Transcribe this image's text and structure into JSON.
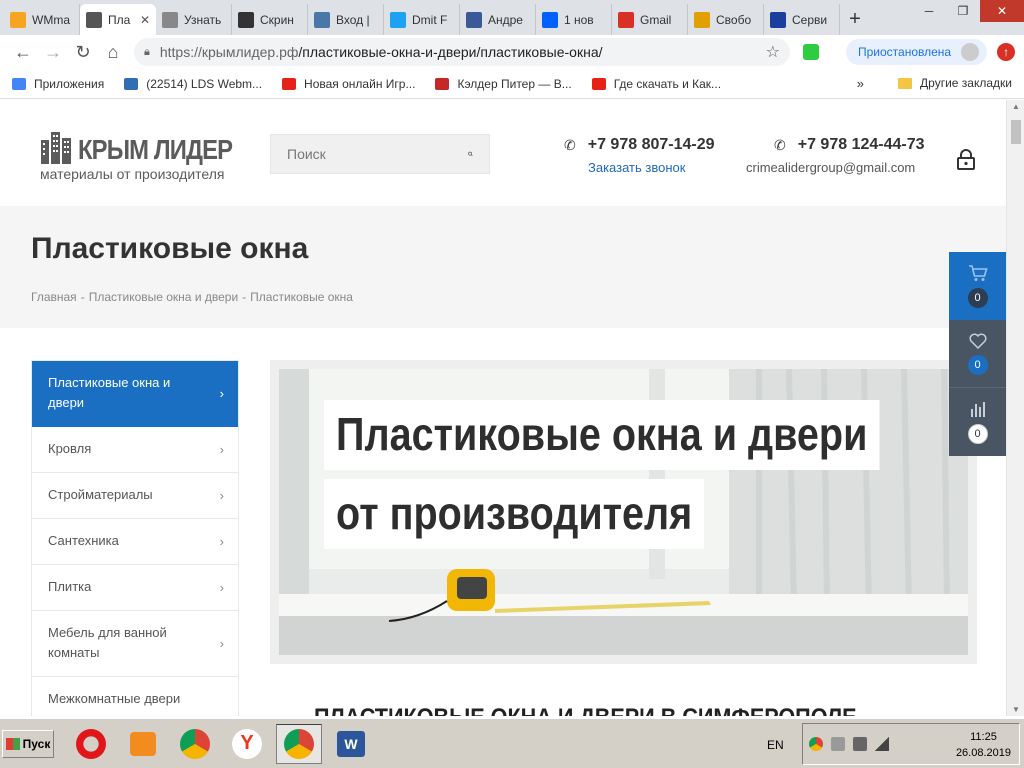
{
  "browser": {
    "tabs": [
      {
        "label": "WMma",
        "icon_color": "#f7a520",
        "active": false
      },
      {
        "label": "Пла",
        "icon_color": "#555555",
        "active": true
      },
      {
        "label": "Узнать",
        "icon_color": "#888888",
        "active": false
      },
      {
        "label": "Скрин",
        "icon_color": "#333333",
        "active": false
      },
      {
        "label": "Вход |",
        "icon_color": "#4a76a8",
        "active": false
      },
      {
        "label": "Dmit F",
        "icon_color": "#1da1f2",
        "active": false
      },
      {
        "label": "Андре",
        "icon_color": "#3b5998",
        "active": false
      },
      {
        "label": "1 нов",
        "icon_color": "#0061ff",
        "active": false
      },
      {
        "label": "Gmail",
        "icon_color": "#d93025",
        "active": false
      },
      {
        "label": "Свобо",
        "icon_color": "#e0a000",
        "active": false
      },
      {
        "label": "Серви",
        "icon_color": "#1b3f9c",
        "active": false
      }
    ],
    "url_host": "https://крымлидер.рф",
    "url_path": "/пластиковые-окна-и-двери/пластиковые-окна/",
    "profile_status": "Приостановлена",
    "bookmarks": [
      {
        "label": "Приложения",
        "color": "#4285f4"
      },
      {
        "label": "(22514) LDS Webm...",
        "color": "#2f6db5"
      },
      {
        "label": "Новая онлайн Игр...",
        "color": "#e62117"
      },
      {
        "label": "Кэлдер Питер — В...",
        "color": "#c62828"
      },
      {
        "label": "Где скачать и Как...",
        "color": "#e62117"
      }
    ],
    "bookmarks_more": "»",
    "other_bookmarks": "Другие закладки"
  },
  "site": {
    "logo_name": "КРЫМ ЛИДЕР",
    "logo_tagline": "материалы от произодителя",
    "search_placeholder": "Поиск",
    "phone1": "+7 978 807-14-29",
    "phone1_link": "Заказать звонок",
    "phone2": "+7 978 124-44-73",
    "email": "crimealidergroup@gmail.com",
    "page_title": "Пластиковые окна",
    "breadcrumb": [
      "Главная",
      "-",
      "Пластиковые окна и двери",
      "-",
      "Пластиковые окна"
    ],
    "menu": [
      {
        "label": "Пластиковые окна и двери",
        "active": true,
        "arrow": true
      },
      {
        "label": "Кровля",
        "active": false,
        "arrow": true
      },
      {
        "label": "Стройматериалы",
        "active": false,
        "arrow": true
      },
      {
        "label": "Сантехника",
        "active": false,
        "arrow": true
      },
      {
        "label": "Плитка",
        "active": false,
        "arrow": true
      },
      {
        "label": "Мебель для ванной комнаты",
        "active": false,
        "arrow": true
      },
      {
        "label": "Межкомнатные двери",
        "active": false,
        "arrow": false
      }
    ],
    "banner_line1": "Пластиковые окна и двери",
    "banner_line2": "от производителя",
    "section_heading": "ПЛАСТИКОВЫЕ ОКНА И ДВЕРИ В СИМФЕРОПОЛЕ",
    "widget": {
      "cart_count": "0",
      "favorites_count": "0",
      "compare_count": "0"
    },
    "accent_color": "#1b6fc3"
  },
  "taskbar": {
    "start_label": "Пуск",
    "lang": "EN",
    "time": "11:25",
    "date": "26.08.2019"
  }
}
